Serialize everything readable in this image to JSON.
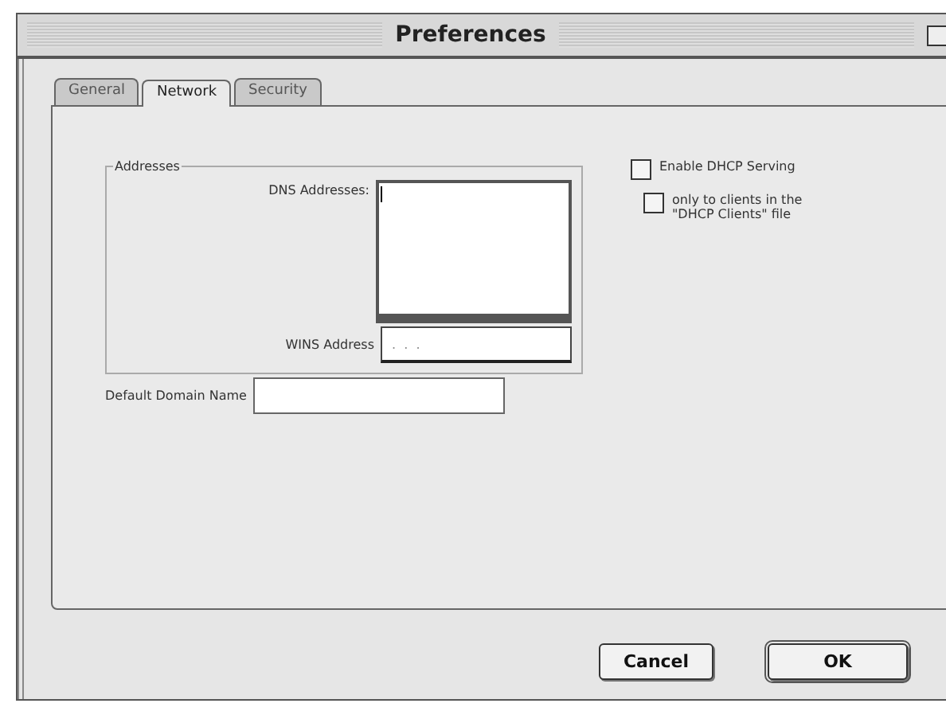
{
  "window": {
    "title": "Preferences"
  },
  "tabs": [
    {
      "label": "General",
      "selected": false
    },
    {
      "label": "Network",
      "selected": true
    },
    {
      "label": "Security",
      "selected": false
    }
  ],
  "addresses": {
    "legend": "Addresses",
    "dns_label": "DNS Addresses:",
    "wins_label": "WINS Address",
    "wins_value": ".  .  ."
  },
  "domain": {
    "label": "Default Domain Name"
  },
  "options": [
    {
      "label": "Enable DHCP Serving",
      "checked": false
    },
    {
      "label": "only to clients in the \"DHCP Clients\" file",
      "checked": false
    }
  ],
  "buttons": [
    {
      "label": "Cancel",
      "kind": "cancel"
    },
    {
      "label": "OK",
      "kind": "default"
    }
  ]
}
